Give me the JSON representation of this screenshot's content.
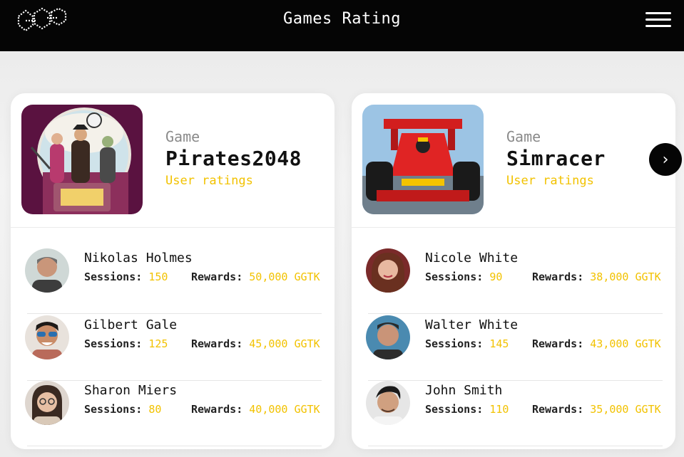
{
  "header": {
    "title": "Games Rating",
    "logo_icon": "hexagon-dots-logo-icon",
    "menu_icon": "hamburger-menu-icon"
  },
  "colors": {
    "accent": "#f2c200",
    "header_bg": "#050505",
    "card_bg": "#ffffff"
  },
  "games": [
    {
      "label": "Game",
      "name": "Pirates2048",
      "ratings_link": "User ratings",
      "thumbnail": "pirates-artwork",
      "users": [
        {
          "name": "Nikolas Holmes",
          "sessions_label": "Sessions:",
          "sessions": "150",
          "rewards_label": "Rewards:",
          "rewards": "50,000 GGTK"
        },
        {
          "name": "Gilbert Gale",
          "sessions_label": "Sessions:",
          "sessions": "125",
          "rewards_label": "Rewards:",
          "rewards": "45,000 GGTK"
        },
        {
          "name": "Sharon Miers",
          "sessions_label": "Sessions:",
          "sessions": "80",
          "rewards_label": "Rewards:",
          "rewards": "40,000 GGTK"
        }
      ]
    },
    {
      "label": "Game",
      "name": "Simracer",
      "ratings_link": "User ratings",
      "thumbnail": "race-car-artwork",
      "users": [
        {
          "name": "Nicole White",
          "sessions_label": "Sessions:",
          "sessions": "90",
          "rewards_label": "Rewards:",
          "rewards": "38,000 GGTK"
        },
        {
          "name": "Walter White",
          "sessions_label": "Sessions:",
          "sessions": "145",
          "rewards_label": "Rewards:",
          "rewards": "43,000 GGTK"
        },
        {
          "name": "John Smith",
          "sessions_label": "Sessions:",
          "sessions": "110",
          "rewards_label": "Rewards:",
          "rewards": "35,000 GGTK"
        }
      ]
    }
  ],
  "carousel": {
    "next_icon": "chevron-right-icon",
    "next_glyph": "›"
  }
}
